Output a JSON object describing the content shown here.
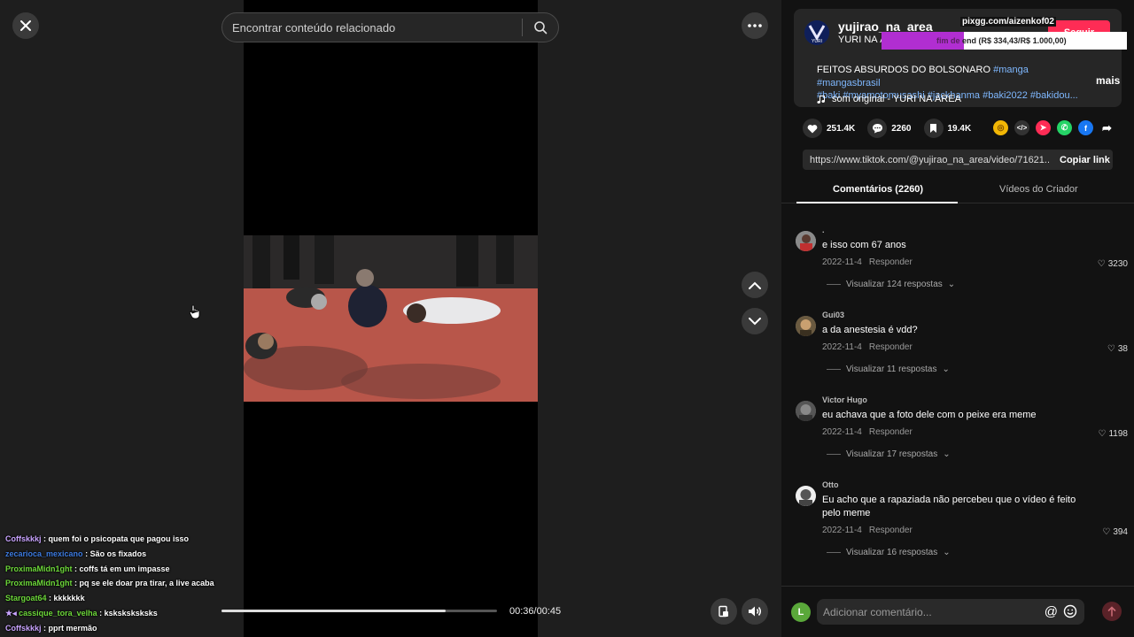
{
  "search": {
    "placeholder": "Encontrar conteúdo relacionado"
  },
  "player": {
    "time": "00:36/00:45",
    "progress_fraction": 0.815
  },
  "chat": [
    {
      "user": "Coffskkkj",
      "color": "#c9a4ff",
      "msg": "quem foi o psicopata que pagou isso"
    },
    {
      "user": "zecarioca_mexicano",
      "color": "#3d7be0",
      "msg": "São os fixados"
    },
    {
      "user": "ProximaMidn1ght",
      "color": "#6dd83a",
      "msg": "coffs tá em um impasse"
    },
    {
      "user": "ProximaMidn1ght",
      "color": "#6dd83a",
      "msg": "pq se ele doar pra tirar, a live acaba"
    },
    {
      "user": "Stargoat64",
      "color": "#6dd83a",
      "msg": "kkkkkkk"
    },
    {
      "user": "cassique_tora_velha",
      "color": "#6dd83a",
      "msg": "ksksksksksks"
    },
    {
      "user": "Coffskkkj",
      "color": "#c9a4ff",
      "msg": "pprt mermão"
    }
  ],
  "creator": {
    "username": "yujirao_na_area",
    "nickname": "YURI NA Á",
    "follow_label": "Seguir"
  },
  "overlay": {
    "pix_link": "pixgg.com/aizenkof02",
    "donation_prefix": "fim de",
    "donation_text": "end (R$ 334,43/R$ 1.000,00)",
    "donation_fraction": 0.334
  },
  "description": {
    "text": "FEITOS ABSURDOS DO BOLSONARO",
    "tags_line1": "#manga #mangasbrasil",
    "tags_line2": "#baki #myamotomusashi #jackhanma #baki2022 #bakidou...",
    "more": "mais",
    "sound": "som original - YURI NA ÁREA"
  },
  "stats": {
    "likes": "251.4K",
    "comments": "2260",
    "saves": "19.4K"
  },
  "link": {
    "url": "https://www.tiktok.com/@yujirao_na_area/video/71621...",
    "copy_label": "Copiar link"
  },
  "tabs": {
    "comments": "Comentários (2260)",
    "creator_videos": "Vídeos do Criador"
  },
  "comments": [
    {
      "name": ".",
      "text": "e isso com 67 anos",
      "date": "2022-11-4",
      "reply": "Responder",
      "likes": "3230",
      "replies": "Visualizar 124 respostas"
    },
    {
      "name": "Gui03",
      "text": "a da anestesia é vdd?",
      "date": "2022-11-4",
      "reply": "Responder",
      "likes": "38",
      "replies": "Visualizar 11 respostas"
    },
    {
      "name": "Victor Hugo",
      "text": "eu achava que a foto dele com o peixe era meme",
      "date": "2022-11-4",
      "reply": "Responder",
      "likes": "1198",
      "replies": "Visualizar 17 respostas"
    },
    {
      "name": "Otto",
      "text": "Eu acho que a rapaziada não percebeu que o vídeo é feito pelo meme",
      "date": "2022-11-4",
      "reply": "Responder",
      "likes": "394",
      "replies": "Visualizar 16 respostas"
    }
  ],
  "comment_input": {
    "avatar_letter": "L",
    "placeholder": "Adicionar comentário..."
  }
}
